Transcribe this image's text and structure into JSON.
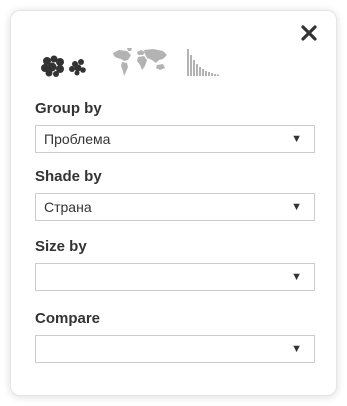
{
  "panel": {
    "close_icon": "close-icon",
    "view_toggles": [
      {
        "name": "bubble-view-icon"
      },
      {
        "name": "world-map-icon"
      },
      {
        "name": "bar-chart-icon"
      }
    ]
  },
  "fields": [
    {
      "label": "Group by",
      "value": "Проблема"
    },
    {
      "label": "Shade by",
      "value": "Страна"
    },
    {
      "label": "Size by",
      "value": ""
    },
    {
      "label": "Compare",
      "value": ""
    }
  ],
  "icons": {
    "dropdown_arrow": "▼"
  },
  "colors": {
    "icon_dark": "#333333",
    "icon_light": "#b3b3b3",
    "border": "#cccccc"
  }
}
